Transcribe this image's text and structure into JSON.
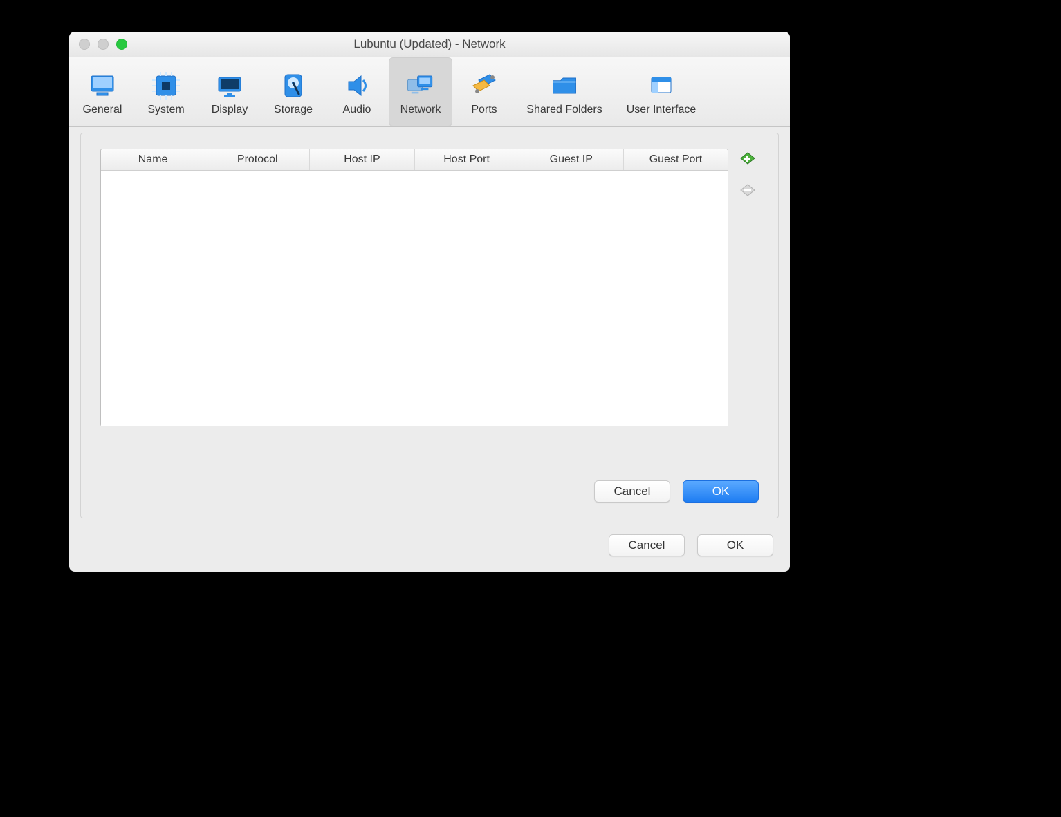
{
  "window": {
    "title": "Lubuntu (Updated) - Network"
  },
  "toolbar": {
    "items": [
      {
        "id": "general",
        "label": "General"
      },
      {
        "id": "system",
        "label": "System"
      },
      {
        "id": "display",
        "label": "Display"
      },
      {
        "id": "storage",
        "label": "Storage"
      },
      {
        "id": "audio",
        "label": "Audio"
      },
      {
        "id": "network",
        "label": "Network",
        "selected": true
      },
      {
        "id": "ports",
        "label": "Ports"
      },
      {
        "id": "shared-folders",
        "label": "Shared Folders"
      },
      {
        "id": "user-interface",
        "label": "User Interface"
      }
    ]
  },
  "port_table": {
    "columns": [
      "Name",
      "Protocol",
      "Host IP",
      "Host Port",
      "Guest IP",
      "Guest Port"
    ],
    "rows": []
  },
  "buttons": {
    "cancel": "Cancel",
    "ok": "OK"
  }
}
